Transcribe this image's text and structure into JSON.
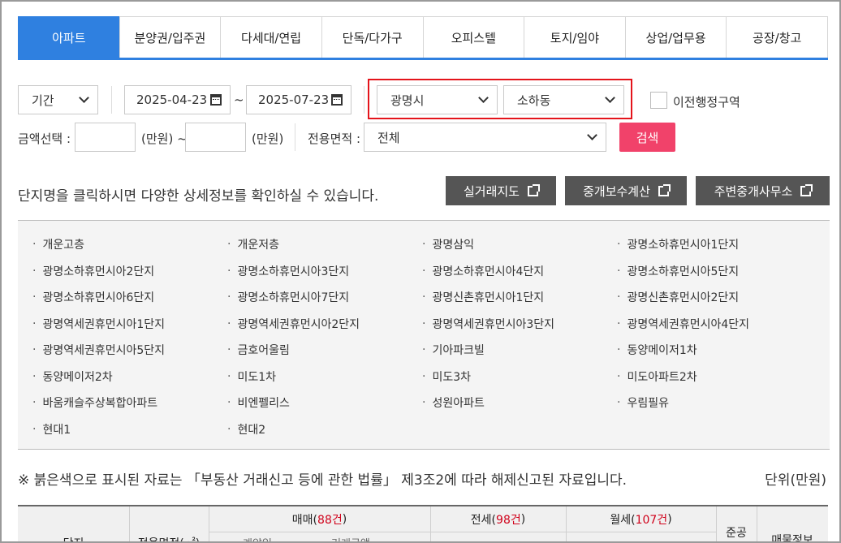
{
  "tabs": [
    {
      "label": "아파트",
      "active": true
    },
    {
      "label": "분양권/입주권",
      "active": false
    },
    {
      "label": "다세대/연립",
      "active": false
    },
    {
      "label": "단독/다가구",
      "active": false
    },
    {
      "label": "오피스텔",
      "active": false
    },
    {
      "label": "토지/임야",
      "active": false
    },
    {
      "label": "상업/업무용",
      "active": false
    },
    {
      "label": "공장/창고",
      "active": false
    }
  ],
  "filters": {
    "period": "기간",
    "date_from": "2025-04-23",
    "tilde": "~",
    "date_to": "2025-07-23",
    "city": "광명시",
    "dong": "소하동",
    "prev_region_label": "이전행정구역",
    "amount_label": "금액선택 :",
    "unit_min": "(만원) ~",
    "unit_max": "(만원)",
    "area_label": "전용면적 :",
    "area_value": "전체",
    "search_button": "검색"
  },
  "info": {
    "text": "단지명을 클릭하시면 다양한 상세정보를 확인하실 수 있습니다.",
    "buttons": [
      "실거래지도",
      "중개보수계산",
      "주변중개사무소"
    ]
  },
  "complexes": [
    "개운고층",
    "개운저층",
    "광명삼익",
    "광명소하휴먼시아1단지",
    "광명소하휴먼시아2단지",
    "광명소하휴먼시아3단지",
    "광명소하휴먼시아4단지",
    "광명소하휴먼시아5단지",
    "광명소하휴먼시아6단지",
    "광명소하휴먼시아7단지",
    "광명신촌휴먼시아1단지",
    "광명신촌휴먼시아2단지",
    "광명역세권휴먼시아1단지",
    "광명역세권휴먼시아2단지",
    "광명역세권휴먼시아3단지",
    "광명역세권휴먼시아4단지",
    "광명역세권휴먼시아5단지",
    "금호어울림",
    "기아파크빌",
    "동양메이저1차",
    "동양메이저2차",
    "미도1차",
    "미도3차",
    "미도아파트2차",
    "바움캐슬주상복합아파트",
    "비엔펠리스",
    "성원아파트",
    "우림필유",
    "현대1",
    "현대2"
  ],
  "notice": {
    "text": "※ 붉은색으로 표시된 자료는 「부동산 거래신고 등에 관한 법률」 제3조2에 따라 해제신고된 자료입니다.",
    "unit": "단위(만원)"
  },
  "table": {
    "col_complex": "단지",
    "col_area": "전용면적(㎡)",
    "sale_prefix": "매매(",
    "sale_count": "88건",
    "jeonse_prefix": "전세(",
    "jeonse_count": "98건",
    "monthly_prefix": "월세(",
    "monthly_count": "107건",
    "close_paren": ")",
    "col_built": "준공",
    "col_listing": "매물정보",
    "sub_contract": "계약일",
    "sub_price": "거래금액"
  }
}
